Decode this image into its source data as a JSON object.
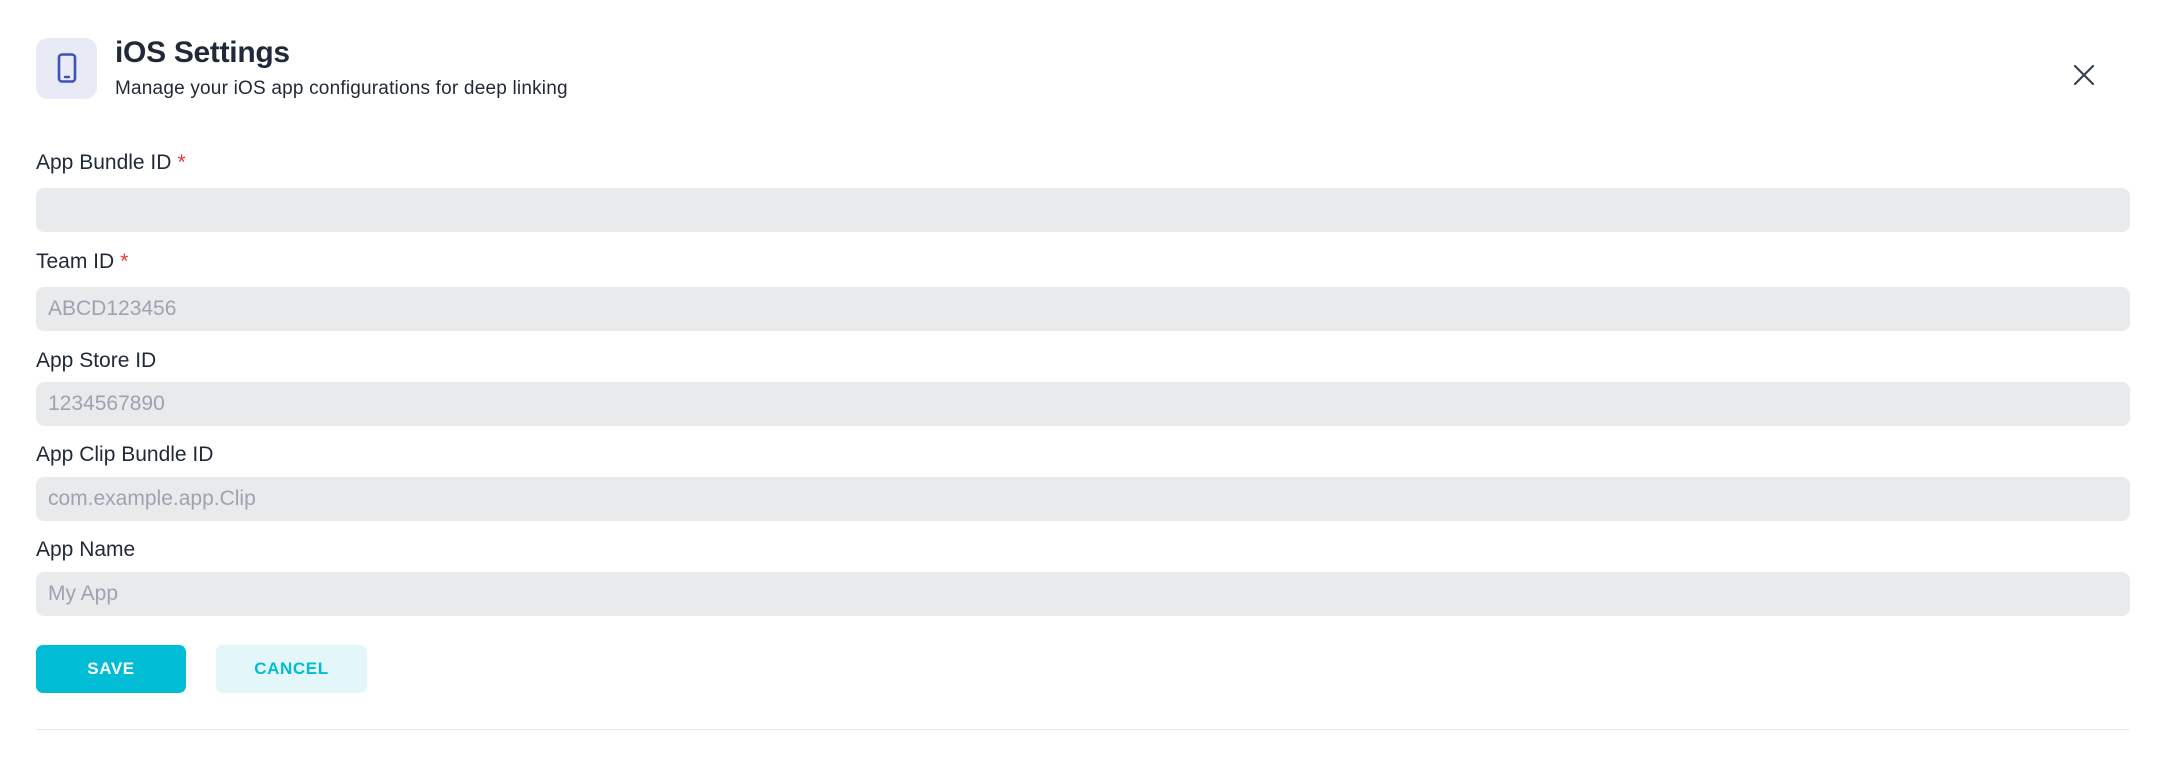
{
  "header": {
    "title": "iOS Settings",
    "subtitle": "Manage your iOS app configurations for deep linking",
    "icon": "smartphone-icon",
    "close_icon": "close-icon"
  },
  "form": {
    "fields": [
      {
        "label": "App Bundle ID",
        "required_mark": "*",
        "value": "",
        "placeholder": ""
      },
      {
        "label": "Team ID",
        "required_mark": "*",
        "value": "",
        "placeholder": "ABCD123456"
      },
      {
        "label": "App Store ID",
        "value": "",
        "placeholder": "1234567890"
      },
      {
        "label": "App Clip Bundle ID",
        "value": "",
        "placeholder": "com.example.app.Clip"
      },
      {
        "label": "App Name",
        "value": "",
        "placeholder": "My App"
      }
    ]
  },
  "actions": {
    "save_label": "SAVE",
    "cancel_label": "CANCEL"
  },
  "colors": {
    "accent": "#00bcd4",
    "required": "#e53935",
    "input_bg": "#e9eaec",
    "icon_bg": "#e8ebf6",
    "icon_color": "#3f51b5"
  }
}
